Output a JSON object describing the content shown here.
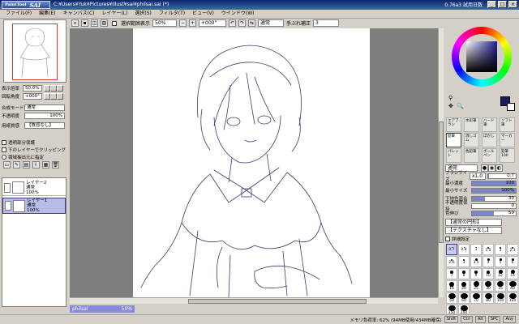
{
  "window": {
    "app_logo": "SAI",
    "app_logo_sub": "PaintTool",
    "title": "C:¥Users¥Yuk¥Pictures¥Illust¥sai¥philsai.sai (*)",
    "version": "0.76a3 試用日数",
    "min": "_",
    "max": "□",
    "close": "×"
  },
  "menu": [
    "ファイル(F)",
    "編集(E)",
    "キャンバス(C)",
    "レイヤー(L)",
    "選択(S)",
    "フィルタ(T)",
    "ビュー(V)",
    "ウインドウ(W)"
  ],
  "navigator": {
    "zoom_label": "表示倍率",
    "zoom_value": "50.0%",
    "angle_label": "回転角度",
    "angle_value": "+000°"
  },
  "layer_props": {
    "blend_label": "合成モード",
    "blend_value": "通常",
    "opacity_label": "不透明度",
    "opacity_value": "100%",
    "paper_label": "用紙質感",
    "paper_value": "【質感なし】",
    "check_transparency": "透明部分保護",
    "check_lower_clip": "下のレイヤーでクリッピング",
    "check_selection_source": "領域抽出元に指定"
  },
  "layers": [
    {
      "name": "レイヤー2",
      "mode": "通常",
      "opacity": "100%",
      "selected": false
    },
    {
      "name": "レイヤー1",
      "mode": "通常",
      "opacity": "100%",
      "selected": true
    }
  ],
  "canvas_toolbar": {
    "antialias_label": "選択範囲表示",
    "zoom": "50%",
    "angle": "+000°",
    "mode": "通常",
    "stabilizer_label": "手ぶれ補正",
    "stabilizer_value": "3"
  },
  "doc_tab": {
    "name": "philsai",
    "zoom": "50%"
  },
  "status": {
    "memory": "メモリ負荷率: 62% (94MB使用/434MB確保)",
    "ind1": "Shift",
    "ind2": "Ctrl",
    "ind3": "Alt",
    "ind4": "SPC",
    "ind5": "Any"
  },
  "colors": {
    "current": "#1b1860",
    "secondary": "#ffffff",
    "wheel_center": "#202070",
    "accent": "#7b86c4"
  },
  "tools": [
    {
      "label": "エアブラシ",
      "active": true
    },
    {
      "label": "水彩筆",
      "active": false
    },
    {
      "label": "ハード筆",
      "active": false
    },
    {
      "label": "ソフト筆",
      "active": false
    },
    {
      "label": "鉛筆",
      "active": false
    },
    {
      "label": "消しゴム",
      "active": false
    },
    {
      "label": "ぼかし",
      "active": false
    },
    {
      "label": "マーカー",
      "active": false
    },
    {
      "label": "パレット",
      "active": false
    },
    {
      "label": "色鉛筆",
      "active": false
    },
    {
      "label": "ボールペン",
      "active": false
    },
    {
      "label": "鉛筆100",
      "active": false
    }
  ],
  "brush": {
    "mode": "通常",
    "size_label": "ブラシサイズ",
    "size_mult": "x1.0",
    "size_value": "0.7",
    "density_label": "最小濃度",
    "density_value": "100",
    "min_size_label": "最小サイズ",
    "min_size_value": "100%",
    "blend_label": "下地色混合",
    "blend_value": "30",
    "keep_label": "不透明度保持",
    "keep_value": "0",
    "extend_label": "色伸び",
    "extend_value": "50",
    "shape_label": "【通常の円形】",
    "texture_label": "【テクスチャなし】",
    "detail_label": "詳細設定"
  },
  "brush_sizes": [
    "0.7",
    "0.8",
    "1",
    "1.5",
    "2",
    "2.3",
    "2.6",
    "3",
    "3.5",
    "4",
    "5",
    "6",
    "7",
    "8",
    "9",
    "10",
    "12",
    "14",
    "16",
    "20",
    "25",
    "30",
    "35",
    "40",
    "50",
    "60",
    "70",
    "80",
    "100",
    "120",
    "150",
    "200"
  ]
}
